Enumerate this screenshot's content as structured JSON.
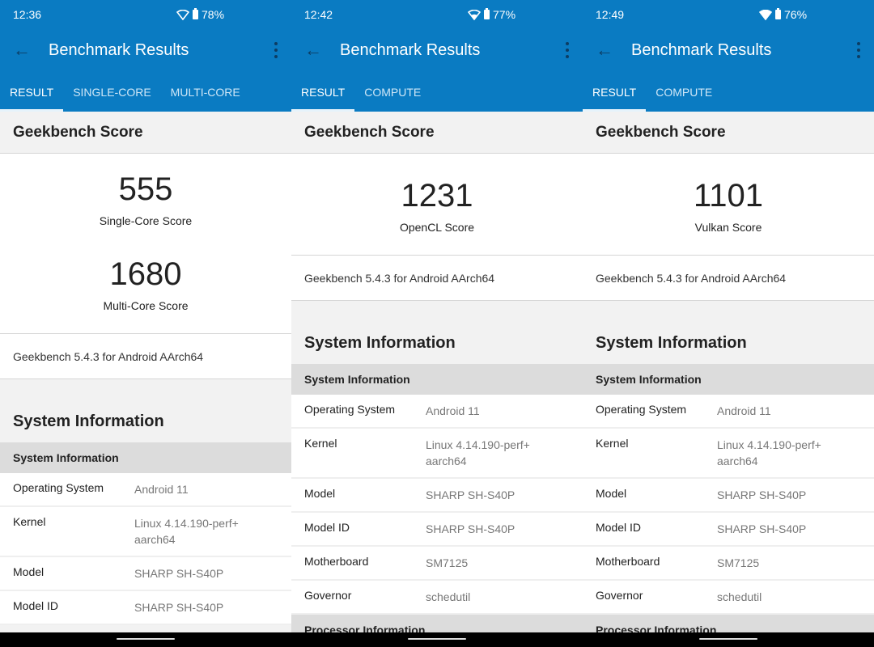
{
  "colors": {
    "appbar": "#0a7bc2",
    "icon_dark": "#0c3d63"
  },
  "screens": [
    {
      "status": {
        "time": "12:36",
        "battery": "78%",
        "wifi": "wifi-outline-icon"
      },
      "title": "Benchmark Results",
      "tabs": [
        {
          "label": "RESULT",
          "active": true
        },
        {
          "label": "SINGLE-CORE"
        },
        {
          "label": "MULTI-CORE"
        }
      ],
      "section": "Geekbench Score",
      "scores": [
        {
          "value": "555",
          "label": "Single-Core Score"
        },
        {
          "value": "1680",
          "label": "Multi-Core Score"
        }
      ],
      "version": "Geekbench 5.4.3 for Android AArch64",
      "sysinfo_title": "System Information",
      "table_head": "System Information",
      "rows": [
        {
          "k": "Operating System",
          "v": "Android 11"
        },
        {
          "k": "Kernel",
          "v": "Linux 4.14.190-perf+ aarch64"
        },
        {
          "k": "Model",
          "v": "SHARP SH-S40P"
        },
        {
          "k": "Model ID",
          "v": "SHARP SH-S40P"
        }
      ]
    },
    {
      "status": {
        "time": "12:42",
        "battery": "77%",
        "wifi": "wifi-partial-icon"
      },
      "title": "Benchmark Results",
      "tabs": [
        {
          "label": "RESULT",
          "active": true
        },
        {
          "label": "COMPUTE"
        }
      ],
      "section": "Geekbench Score",
      "scores": [
        {
          "value": "1231",
          "label": "OpenCL Score"
        }
      ],
      "version": "Geekbench 5.4.3 for Android AArch64",
      "sysinfo_title": "System Information",
      "table_head": "System Information",
      "rows": [
        {
          "k": "Operating System",
          "v": "Android 11"
        },
        {
          "k": "Kernel",
          "v": "Linux 4.14.190-perf+ aarch64"
        },
        {
          "k": "Model",
          "v": "SHARP SH-S40P"
        },
        {
          "k": "Model ID",
          "v": "SHARP SH-S40P"
        },
        {
          "k": "Motherboard",
          "v": "SM7125"
        },
        {
          "k": "Governor",
          "v": "schedutil"
        }
      ],
      "table_head2": "Processor Information"
    },
    {
      "status": {
        "time": "12:49",
        "battery": "76%",
        "wifi": "wifi-full-icon"
      },
      "title": "Benchmark Results",
      "tabs": [
        {
          "label": "RESULT",
          "active": true
        },
        {
          "label": "COMPUTE"
        }
      ],
      "section": "Geekbench Score",
      "scores": [
        {
          "value": "1101",
          "label": "Vulkan Score"
        }
      ],
      "version": "Geekbench 5.4.3 for Android AArch64",
      "sysinfo_title": "System Information",
      "table_head": "System Information",
      "rows": [
        {
          "k": "Operating System",
          "v": "Android 11"
        },
        {
          "k": "Kernel",
          "v": "Linux 4.14.190-perf+ aarch64"
        },
        {
          "k": "Model",
          "v": "SHARP SH-S40P"
        },
        {
          "k": "Model ID",
          "v": "SHARP SH-S40P"
        },
        {
          "k": "Motherboard",
          "v": "SM7125"
        },
        {
          "k": "Governor",
          "v": "schedutil"
        }
      ],
      "table_head2": "Processor Information"
    }
  ]
}
